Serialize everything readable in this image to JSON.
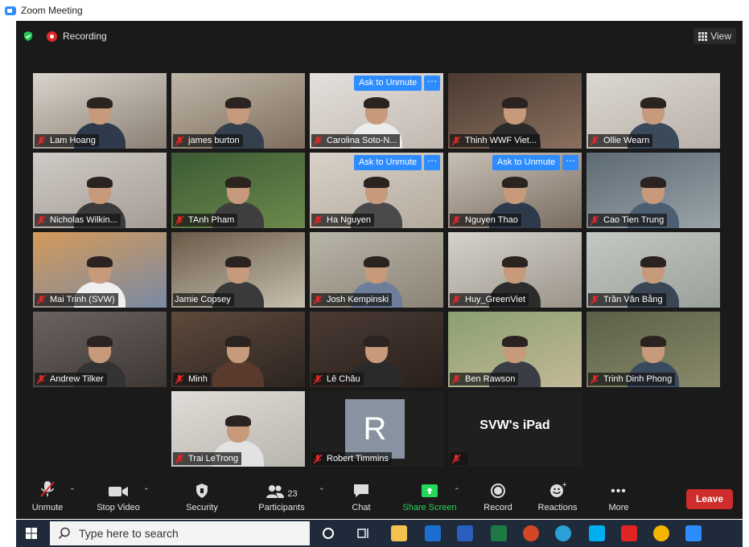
{
  "window": {
    "title": "Zoom Meeting"
  },
  "topbar": {
    "recording_label": "Recording",
    "view_label": "View"
  },
  "tiles": [
    {
      "name": "Lam Hoang",
      "muted": true
    },
    {
      "name": "james burton",
      "muted": true
    },
    {
      "name": "Carolina Soto-N...",
      "muted": true,
      "ask": "Ask to Unmute"
    },
    {
      "name": "Thinh WWF Viet...",
      "muted": true
    },
    {
      "name": "Ollie Wearn",
      "muted": true
    },
    {
      "name": "Nicholas Wilkin...",
      "muted": true
    },
    {
      "name": "TAnh Pham",
      "muted": true
    },
    {
      "name": "Ha Nguyen",
      "muted": true,
      "ask": "Ask to Unmute"
    },
    {
      "name": "Nguyen Thao",
      "muted": true,
      "ask": "Ask to Unmute"
    },
    {
      "name": "Cao Tien Trung",
      "muted": true
    },
    {
      "name": "Mai Trinh (SVW)",
      "muted": true
    },
    {
      "name": "Jamie Copsey",
      "muted": false,
      "active": true
    },
    {
      "name": "Josh Kempinski",
      "muted": true
    },
    {
      "name": "Huy_GreenViet",
      "muted": true
    },
    {
      "name": "Trần Văn Bằng",
      "muted": true
    },
    {
      "name": "Andrew Tilker",
      "muted": true
    },
    {
      "name": "Minh",
      "muted": true
    },
    {
      "name": "Lê Châu",
      "muted": true
    },
    {
      "name": "Ben Rawson",
      "muted": true
    },
    {
      "name": "Trinh Dinh Phong",
      "muted": true
    },
    {
      "name": "Trai LeTrong",
      "muted": true
    },
    {
      "name": "Robert Timmins",
      "muted": true,
      "avatar_letter": "R"
    },
    {
      "name": "",
      "muted": true,
      "device_label": "SVW's iPad"
    }
  ],
  "toolbar": {
    "unmute": "Unmute",
    "stop_video": "Stop Video",
    "security": "Security",
    "participants": "Participants",
    "participants_count": "23",
    "chat": "Chat",
    "share_screen": "Share Screen",
    "record": "Record",
    "reactions": "Reactions",
    "more": "More",
    "leave": "Leave"
  },
  "taskbar": {
    "search_placeholder": "Type here to search"
  },
  "colors": {
    "accent": "#2d8cff",
    "leave": "#cf2c2c",
    "share": "#24d65a",
    "active_speaker": "#d9e65a"
  }
}
